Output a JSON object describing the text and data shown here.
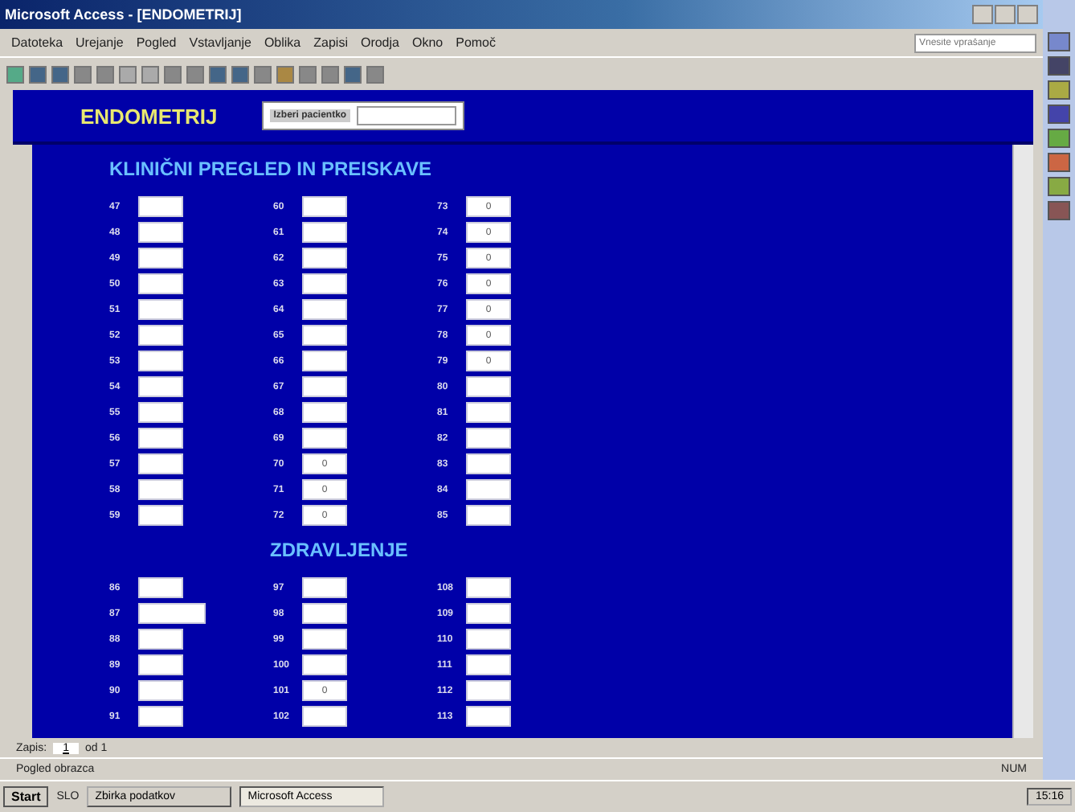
{
  "window": {
    "title": "Microsoft Access - [ENDOMETRIJ]"
  },
  "menus": [
    {
      "label": "Datoteka"
    },
    {
      "label": "Urejanje"
    },
    {
      "label": "Pogled"
    },
    {
      "label": "Vstavljanje"
    },
    {
      "label": "Oblika"
    },
    {
      "label": "Zapisi"
    },
    {
      "label": "Orodja"
    },
    {
      "label": "Okno"
    },
    {
      "label": "Pomoč"
    }
  ],
  "help_box": {
    "placeholder": "Vnesite vprašanje"
  },
  "form": {
    "title": "ENDOMETRIJ",
    "selector": {
      "label": "Izberi pacientko"
    },
    "sections": [
      {
        "title": "KLINIČNI PREGLED IN PREISKAVE",
        "columns": [
          [
            {
              "label": "47"
            },
            {
              "label": "48"
            },
            {
              "label": "49"
            },
            {
              "label": "50"
            },
            {
              "label": "51"
            },
            {
              "label": "52"
            },
            {
              "label": "53"
            },
            {
              "label": "54"
            },
            {
              "label": "55"
            },
            {
              "label": "56"
            },
            {
              "label": "57"
            },
            {
              "label": "58"
            },
            {
              "label": "59"
            }
          ],
          [
            {
              "label": "60"
            },
            {
              "label": "61"
            },
            {
              "label": "62"
            },
            {
              "label": "63"
            },
            {
              "label": "64"
            },
            {
              "label": "65"
            },
            {
              "label": "66"
            },
            {
              "label": "67"
            },
            {
              "label": "68"
            },
            {
              "label": "69"
            },
            {
              "label": "70",
              "value": "0"
            },
            {
              "label": "71",
              "value": "0"
            },
            {
              "label": "72",
              "value": "0"
            }
          ],
          [
            {
              "label": "73",
              "value": "0"
            },
            {
              "label": "74",
              "value": "0"
            },
            {
              "label": "75",
              "value": "0"
            },
            {
              "label": "76",
              "value": "0"
            },
            {
              "label": "77",
              "value": "0"
            },
            {
              "label": "78",
              "value": "0"
            },
            {
              "label": "79",
              "value": "0"
            },
            {
              "label": "80"
            },
            {
              "label": "81"
            },
            {
              "label": "82"
            },
            {
              "label": "83"
            },
            {
              "label": "84"
            },
            {
              "label": "85"
            }
          ]
        ]
      },
      {
        "title": "ZDRAVLJENJE",
        "columns": [
          [
            {
              "label": "86"
            },
            {
              "label": "87",
              "wide": true
            },
            {
              "label": "88"
            },
            {
              "label": "89"
            },
            {
              "label": "90"
            },
            {
              "label": "91"
            }
          ],
          [
            {
              "label": "97"
            },
            {
              "label": "98"
            },
            {
              "label": "99"
            },
            {
              "label": "100"
            },
            {
              "label": "101",
              "value": "0"
            },
            {
              "label": "102"
            }
          ],
          [
            {
              "label": "108"
            },
            {
              "label": "109"
            },
            {
              "label": "110"
            },
            {
              "label": "111"
            },
            {
              "label": "112"
            },
            {
              "label": "113"
            }
          ]
        ]
      }
    ]
  },
  "record_nav": {
    "label": "Zapis:",
    "current": "1",
    "total": "od 1"
  },
  "status_bar": {
    "text": "Pogled obrazca",
    "indicator": "NUM"
  },
  "taskbar": {
    "start": "Start",
    "quick": "SLO",
    "tasks": [
      {
        "label": "Zbirka podatkov",
        "selected": false
      },
      {
        "label": "Microsoft Access",
        "selected": true
      }
    ],
    "clock": "15:16"
  }
}
